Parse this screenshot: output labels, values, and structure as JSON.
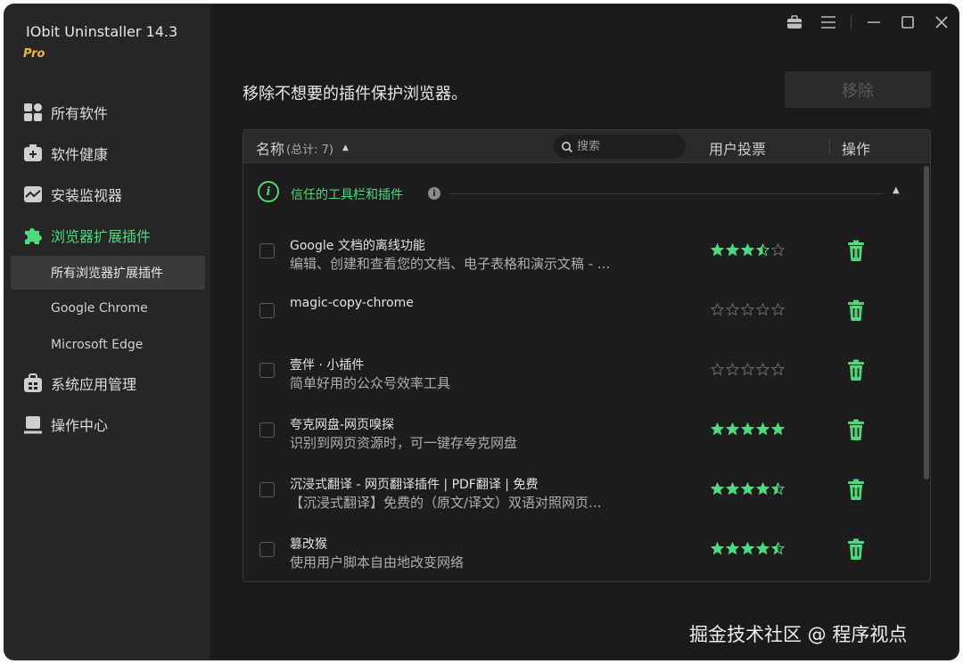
{
  "app": {
    "title": "IObit Uninstaller 14.3",
    "edition": "Pro"
  },
  "sidebar": {
    "items": [
      {
        "label": "所有软件",
        "icon": "apps-grid-icon"
      },
      {
        "label": "软件健康",
        "icon": "health-kit-icon"
      },
      {
        "label": "安装监视器",
        "icon": "monitor-icon"
      },
      {
        "label": "浏览器扩展插件",
        "icon": "puzzle-icon"
      },
      {
        "label": "系统应用管理",
        "icon": "windows-apps-icon"
      },
      {
        "label": "操作中心",
        "icon": "action-center-icon"
      }
    ],
    "subitems": [
      {
        "label": "所有浏览器扩展插件"
      },
      {
        "label": "Google Chrome"
      },
      {
        "label": "Microsoft Edge"
      }
    ]
  },
  "main": {
    "headline": "移除不想要的插件保护浏览器。",
    "remove_button": "移除",
    "table": {
      "col_name": "名称",
      "col_count": "(总计: 7)",
      "search_placeholder": "搜索",
      "col_votes": "用户投票",
      "col_action": "操作",
      "group_label": "信任的工具栏和插件",
      "rows": [
        {
          "title": "Google 文档的离线功能",
          "desc": "编辑、创建和查看您的文档、电子表格和演示文稿 - ...",
          "rating": 3.5
        },
        {
          "title": "magic-copy-chrome",
          "desc": "",
          "rating": 0
        },
        {
          "title": "壹伴 · 小插件",
          "desc": "简单好用的公众号效率工具",
          "rating": 0
        },
        {
          "title": "夸克网盘-网页嗅探",
          "desc": "识别到网页资源时，可一键存夸克网盘",
          "rating": 5
        },
        {
          "title": "沉浸式翻译 - 网页翻译插件 | PDF翻译 | 免费",
          "desc": "【沉浸式翻译】免费的（原文/译文）双语对照网页...",
          "rating": 4.5
        },
        {
          "title": "篡改猴",
          "desc": "使用用户脚本自由地改变网络",
          "rating": 4.5
        }
      ]
    }
  },
  "watermark": "掘金技术社区 @ 程序视点",
  "colors": {
    "accent": "#4bdb7c",
    "edition": "#e8b92c",
    "background": "#1b1b1b",
    "sidebar": "#262626"
  }
}
